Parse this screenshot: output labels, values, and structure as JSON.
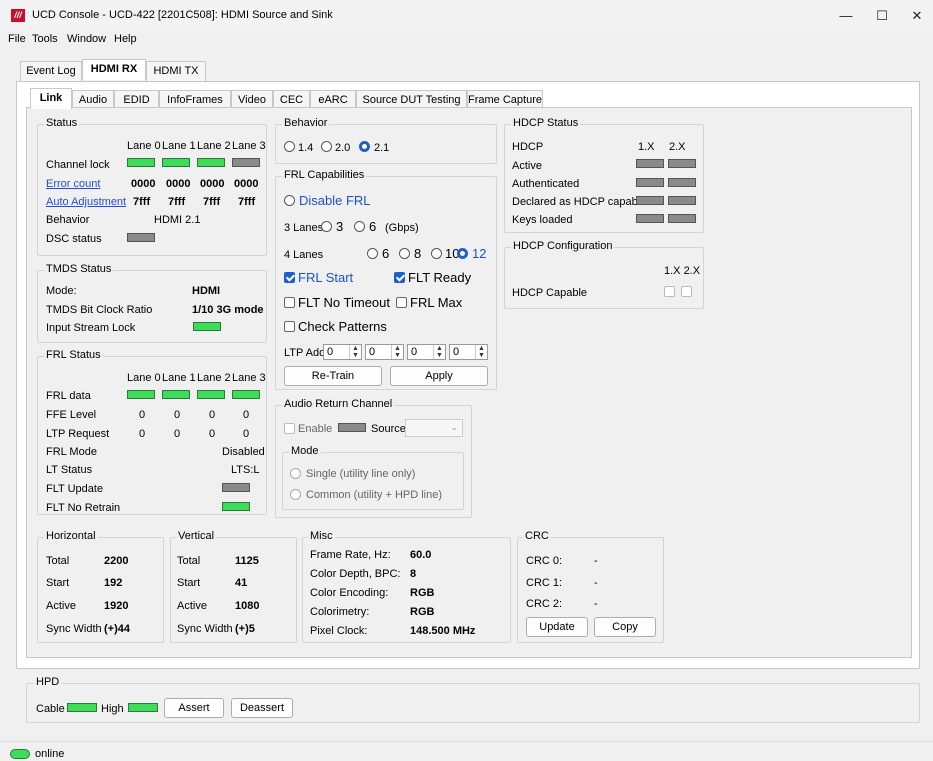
{
  "window": {
    "title": "UCD Console - UCD-422 [2201C508]: HDMI Source and Sink",
    "logo": "///"
  },
  "menu": [
    "File",
    "Tools",
    "Window",
    "Help"
  ],
  "tabs": [
    "Event Log",
    "HDMI RX",
    "HDMI TX"
  ],
  "subtabs": [
    "Link",
    "Audio",
    "EDID",
    "InfoFrames",
    "Video",
    "CEC",
    "eARC",
    "Source DUT Testing",
    "Frame Capture"
  ],
  "status": {
    "title": "Status",
    "lanes": [
      "Lane 0",
      "Lane 1",
      "Lane 2",
      "Lane 3"
    ],
    "channel_lock": "Channel lock",
    "error_count": "Error count",
    "error_vals": [
      "0000",
      "0000",
      "0000",
      "0000"
    ],
    "auto_adj": "Auto Adjustment",
    "auto_vals": [
      "7fff",
      "7fff",
      "7fff",
      "7fff"
    ],
    "behavior_label": "Behavior",
    "behavior_val": "HDMI 2.1",
    "dsc": "DSC status"
  },
  "tmds": {
    "title": "TMDS Status",
    "mode_label": "Mode:",
    "mode_val": "HDMI",
    "ratio_label": "TMDS Bit Clock Ratio",
    "ratio_val": "1/10 3G mode",
    "lock_label": "Input Stream Lock"
  },
  "frl": {
    "title": "FRL Status",
    "lanes": [
      "Lane 0",
      "Lane 1",
      "Lane 2",
      "Lane 3"
    ],
    "data": "FRL data",
    "ffe": "FFE Level",
    "ffe_vals": [
      "0",
      "0",
      "0",
      "0"
    ],
    "ltp": "LTP Request",
    "ltp_vals": [
      "0",
      "0",
      "0",
      "0"
    ],
    "mode": "FRL Mode",
    "mode_val": "Disabled",
    "lt": "LT Status",
    "lt_val": "LTS:L",
    "fltu": "FLT Update",
    "fltnr": "FLT No Retrain"
  },
  "behavior": {
    "title": "Behavior",
    "options": [
      "1.4",
      "2.0",
      "2.1"
    ]
  },
  "frlcap": {
    "title": "FRL Capabilities",
    "disable": "Disable FRL",
    "lanes3": "3 Lanes",
    "opt3": [
      "3",
      "6"
    ],
    "gbps": "(Gbps)",
    "lanes4": "4 Lanes",
    "opt4": [
      "6",
      "8",
      "10",
      "12"
    ],
    "frl_start": "FRL Start",
    "flt_ready": "FLT Ready",
    "flt_no_timeout": "FLT No Timeout",
    "frl_max": "FRL Max",
    "check_patterns": "Check Patterns",
    "ltp_add": "LTP Add",
    "ltp_vals": [
      "0",
      "0",
      "0",
      "0"
    ],
    "retrain": "Re-Train",
    "apply": "Apply"
  },
  "arc": {
    "title": "Audio Return Channel",
    "enable": "Enable",
    "source": "Source",
    "mode": "Mode",
    "single": "Single  (utility line only)",
    "common": "Common  (utility + HPD line)"
  },
  "hdcp": {
    "title": "HDCP Status",
    "col1": "1.X",
    "col2": "2.X",
    "rows": [
      "HDCP",
      "Active",
      "Authenticated",
      "Declared as HDCP capable",
      "Keys loaded"
    ]
  },
  "hdcpcfg": {
    "title": "HDCP Configuration",
    "col": "1.X 2.X",
    "capable": "HDCP Capable"
  },
  "horizontal": {
    "title": "Horizontal",
    "rows": [
      [
        "Total",
        "2200"
      ],
      [
        "Start",
        "192"
      ],
      [
        "Active",
        "1920"
      ],
      [
        "Sync Width",
        "(+)44"
      ]
    ]
  },
  "vertical": {
    "title": "Vertical",
    "rows": [
      [
        "Total",
        "1125"
      ],
      [
        "Start",
        "41"
      ],
      [
        "Active",
        "1080"
      ],
      [
        "Sync Width",
        "(+)5"
      ]
    ]
  },
  "misc": {
    "title": "Misc",
    "rows": [
      [
        "Frame Rate, Hz:",
        "60.0"
      ],
      [
        "Color Depth, BPC:",
        "8"
      ],
      [
        "Color Encoding:",
        "RGB"
      ],
      [
        "Colorimetry:",
        "RGB"
      ],
      [
        "Pixel Clock:",
        "148.500 MHz"
      ]
    ]
  },
  "crc": {
    "title": "CRC",
    "rows": [
      [
        "CRC 0:",
        "-"
      ],
      [
        "CRC 1:",
        "-"
      ],
      [
        "CRC 2:",
        "-"
      ]
    ],
    "update": "Update",
    "copy": "Copy"
  },
  "hpd": {
    "title": "HPD",
    "cable": "Cable",
    "high": "High",
    "assert": "Assert",
    "deassert": "Deassert"
  },
  "statusbar": {
    "text": "online"
  }
}
